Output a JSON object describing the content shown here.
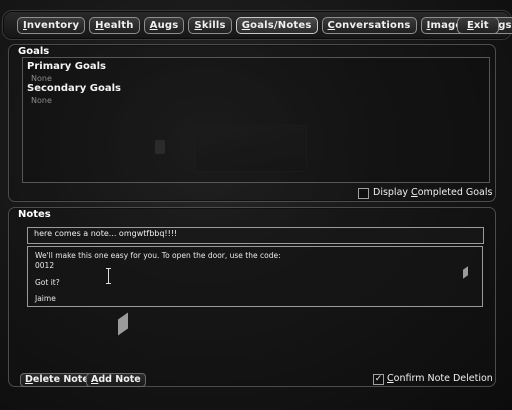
{
  "nav": {
    "tabs": [
      {
        "label": "Inventory",
        "underline": "I",
        "rest": "nventory"
      },
      {
        "label": "Health",
        "underline": "H",
        "rest": "ealth"
      },
      {
        "label": "Augs",
        "underline": "A",
        "rest": "ugs"
      },
      {
        "label": "Skills",
        "underline": "S",
        "rest": "kills"
      },
      {
        "label": "Goals/Notes",
        "underline": "G",
        "rest": "oals/Notes"
      },
      {
        "label": "Conversations",
        "underline": "C",
        "rest": "onversations"
      },
      {
        "label": "Images",
        "underline": "I",
        "rest": "mages"
      },
      {
        "label": "Logs",
        "underline": "L",
        "rest": "ogs"
      }
    ],
    "selected_tab": "Goals/Notes",
    "exit": {
      "label": "Exit",
      "underline": "E",
      "rest": "xit"
    }
  },
  "goals": {
    "title": "Goals",
    "primary_heading": "Primary Goals",
    "primary_none": "None",
    "secondary_heading": "Secondary Goals",
    "secondary_none": "None",
    "display_completed": {
      "label_pre": "Display ",
      "label_ul": "C",
      "label_post": "ompleted Goals",
      "checked": false
    }
  },
  "notes": {
    "title": "Notes",
    "list": [
      "here comes a note... omgwtfbbq!!!!"
    ],
    "selected_note_lines": [
      "We'll make this one easy for you.  To open the door, use the code:",
      "0012",
      "",
      "Got it?",
      "",
      "Jaime"
    ]
  },
  "buttons": {
    "delete_note": {
      "ul": "D",
      "rest": "elete Note"
    },
    "add_note": {
      "ul": "A",
      "rest": "dd Note"
    },
    "confirm_deletion": {
      "label_pre": "",
      "label_ul": "C",
      "label_post": "onfirm Note Deletion",
      "checked": true
    }
  },
  "colors": {
    "panel_border": "#4c4c4c",
    "text_primary": "#f0f0f0",
    "text_dim": "#8d8d8d"
  }
}
